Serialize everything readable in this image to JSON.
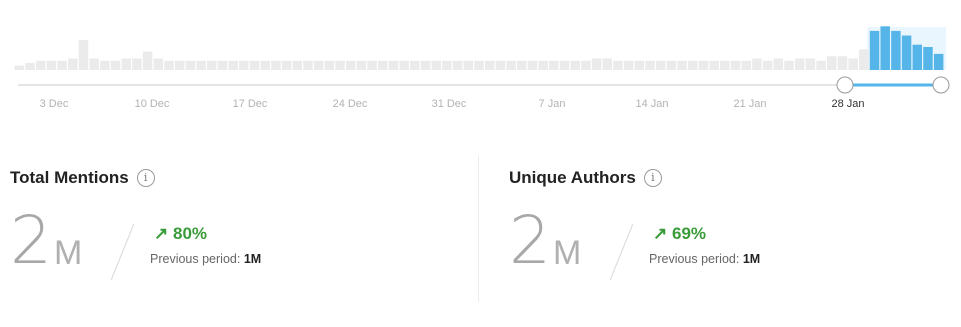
{
  "timeline": {
    "bars": [
      2,
      3,
      4,
      4,
      4,
      5,
      13,
      5,
      4,
      4,
      5,
      5,
      8,
      5,
      4,
      4,
      4,
      4,
      4,
      4,
      4,
      4,
      4,
      4,
      4,
      4,
      4,
      4,
      4,
      4,
      4,
      4,
      4,
      4,
      4,
      4,
      4,
      4,
      4,
      4,
      4,
      4,
      4,
      4,
      4,
      4,
      4,
      4,
      4,
      4,
      4,
      4,
      4,
      4,
      5,
      5,
      4,
      4,
      4,
      4,
      4,
      4,
      4,
      4,
      4,
      4,
      4,
      4,
      4,
      5,
      4,
      5,
      4,
      5,
      5,
      4,
      6,
      6,
      5,
      9,
      17,
      19,
      17,
      15,
      11,
      10,
      7
    ],
    "selected_from": 80,
    "accent_color": "#55b4e8",
    "muted_color": "#ebebeb",
    "tick_labels": [
      "3 Dec",
      "10 Dec",
      "17 Dec",
      "24 Dec",
      "31 Dec",
      "7 Jan",
      "14 Jan",
      "21 Jan",
      "28 Jan"
    ],
    "active_tick": "28 Jan"
  },
  "metrics": [
    {
      "title": "Total Mentions",
      "value": "2",
      "unit": "M",
      "change": "80%",
      "change_arrow": "↗",
      "previous_label": "Previous period:",
      "previous_value": "1M"
    },
    {
      "title": "Unique Authors",
      "value": "2",
      "unit": "M",
      "change": "69%",
      "change_arrow": "↗",
      "previous_label": "Previous period:",
      "previous_value": "1M"
    }
  ],
  "icons": {
    "info": "i"
  }
}
